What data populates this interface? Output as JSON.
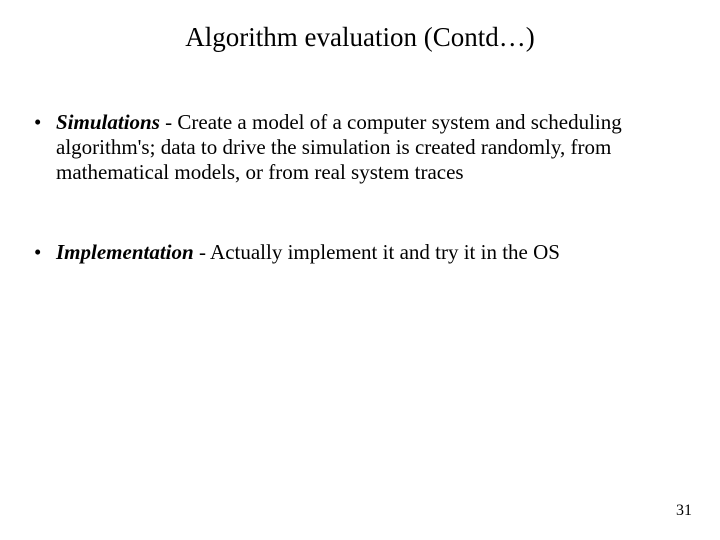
{
  "slide": {
    "title": "Algorithm evaluation (Contd…)",
    "page_number": "31",
    "bullets": [
      {
        "term": "Simulations",
        "rest": " - Create a model of a computer system and scheduling algorithm's; data to drive the simulation is created randomly, from mathematical models, or from real system traces"
      },
      {
        "term": "Implementation",
        "rest": " - Actually implement it and try it in the OS"
      }
    ]
  }
}
